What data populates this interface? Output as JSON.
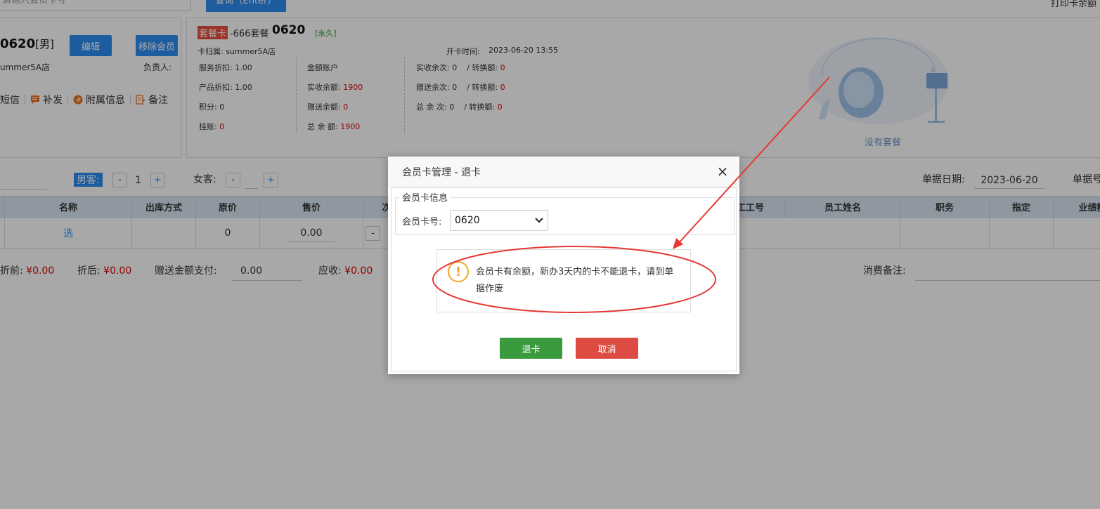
{
  "search": {
    "placeholder": "请输入会员卡号",
    "query_button": "查询（Enter）",
    "print_link": "打印卡余额"
  },
  "member": {
    "number": "0620",
    "gender": "[男]",
    "edit_label": "编辑",
    "remove_label": "移除会员",
    "store": "ummer5A店",
    "owner_label": "负责人:",
    "actions": [
      "短信",
      "补发",
      "附属信息",
      "备注"
    ]
  },
  "card": {
    "type": "套餐卡",
    "name": "-666套餐",
    "number": "0620",
    "validity": "[永久]",
    "belong": "卡归属:  summer5A店",
    "open_time_label": "开卡时间:",
    "open_time": "2023-06-20 13:55",
    "service_discount": "服务折扣: 1.00",
    "product_discount": "产品折扣: 1.00",
    "points": "积分: 0",
    "debt_label": "挂账:",
    "debt_value": "0",
    "account_title": "金额账户",
    "paid_balance_label": "实收余额:",
    "paid_balance": "1900",
    "gift_balance_label": "赠送余额:",
    "gift_balance": "0",
    "total_balance_label": "总  余  额:",
    "total_balance": "1900",
    "times_rows": [
      {
        "label": "实收余次: 0",
        "conv_label": "/ 转换额:",
        "conv_value": "0"
      },
      {
        "label": "赠送余次: 0",
        "conv_label": "/ 转换额:",
        "conv_value": "0"
      },
      {
        "label": "总  余  次: 0",
        "conv_label": "/ 转换额:",
        "conv_value": "0"
      }
    ],
    "no_package": "没有套餐"
  },
  "toolbar": {
    "male_label": "男客:",
    "male_count": "1",
    "female_label": "女客:",
    "minus": "-",
    "plus": "+",
    "date_label": "单据日期:",
    "date_value": "2023-06-20",
    "bill_no_label": "单据号"
  },
  "table": {
    "headers": [
      "名称",
      "出库方式",
      "原价",
      "售价",
      "次数",
      "员工工号",
      "员工姓名",
      "职务",
      "指定",
      "业绩额"
    ],
    "row": {
      "name": "选",
      "orig_price": "0",
      "sale_price": "0.00",
      "minus": "-"
    }
  },
  "summary": {
    "before_label": "折前:",
    "before_value": "¥0.00",
    "after_label": "折后:",
    "after_value": "¥0.00",
    "gift_pay_label": "赠送金额支付:",
    "gift_pay_value": "0.00",
    "receivable_label": "应收:",
    "receivable_value": "¥0.00",
    "remark_label": "消费备注:"
  },
  "dialog": {
    "title": "会员卡管理 - 退卡",
    "close": "×",
    "legend": "会员卡信息",
    "card_label": "会员卡号:",
    "card_value": "0620",
    "warn_mark": "!",
    "message": "会员卡有余额，新办3天内的卡不能退卡，请到单据作废",
    "confirm_label": "退卡",
    "cancel_label": "取消"
  },
  "colors": {
    "primary": "#2d8cf0",
    "success": "#3a9a3e",
    "danger": "#de4b43",
    "card_tag": "#e8513d",
    "annotation": "#e53935",
    "warning": "#f5a623"
  }
}
